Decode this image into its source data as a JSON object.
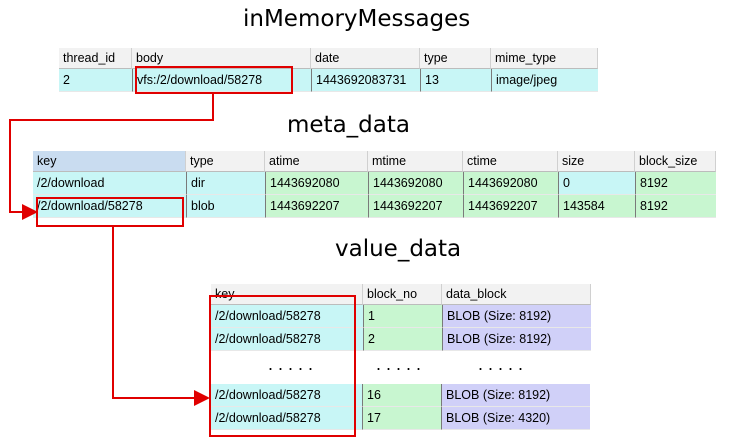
{
  "titles": {
    "in_memory": "inMemoryMessages",
    "meta": "meta_data",
    "value": "value_data"
  },
  "in_memory_messages": {
    "columns": [
      "thread_id",
      "body",
      "date",
      "type",
      "mime_type"
    ],
    "rows": [
      [
        "2",
        "vfs:/2/download/58278",
        "1443692083731",
        "13",
        "image/jpeg"
      ]
    ]
  },
  "meta_data": {
    "columns": [
      "key",
      "type",
      "atime",
      "mtime",
      "ctime",
      "size",
      "block_size"
    ],
    "rows": [
      [
        "/2/download",
        "dir",
        "1443692080",
        "1443692080",
        "1443692080",
        "0",
        "8192"
      ],
      [
        "/2/download/58278",
        "blob",
        "1443692207",
        "1443692207",
        "1443692207",
        "143584",
        "8192"
      ]
    ]
  },
  "value_data": {
    "columns": [
      "key",
      "block_no",
      "data_block"
    ],
    "rows_top": [
      [
        "/2/download/58278",
        "1",
        "BLOB (Size: 8192)"
      ],
      [
        "/2/download/58278",
        "2",
        "BLOB (Size: 8192)"
      ]
    ],
    "ellipsis": ".....",
    "rows_bottom": [
      [
        "/2/download/58278",
        "16",
        "BLOB (Size: 8192)"
      ],
      [
        "/2/download/58278",
        "17",
        "BLOB (Size: 4320)"
      ]
    ]
  },
  "colors": {
    "highlight_red": "#e00000",
    "cyan_cell": "#c8f6f6",
    "green_cell": "#c8f6d0",
    "blob_cell": "#d0d0f8"
  }
}
